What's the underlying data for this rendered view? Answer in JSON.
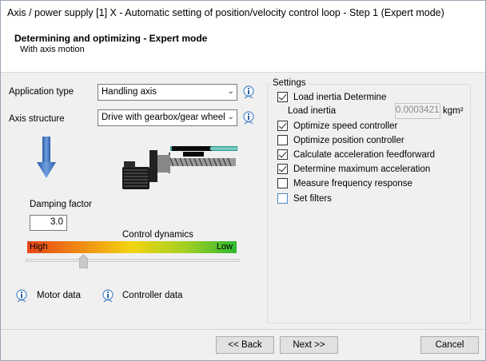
{
  "window": {
    "title": "Axis / power supply [1] X - Automatic setting of position/velocity control loop - Step 1 (Expert mode)"
  },
  "header": {
    "title": "Determining and optimizing - Expert mode",
    "subtitle": "With axis motion"
  },
  "left": {
    "application_type_label": "Application type",
    "application_type_value": "Handling axis",
    "axis_structure_label": "Axis structure",
    "axis_structure_value": "Drive with gearbox/gear wheel",
    "damping_factor_label": "Damping factor",
    "damping_factor_value": "3.0",
    "control_dynamics_label": "Control dynamics",
    "dynamics_high": "High",
    "dynamics_low": "Low",
    "control_dynamics_level": 0.27,
    "motor_data_label": "Motor data",
    "controller_data_label": "Controller data"
  },
  "settings": {
    "title": "Settings",
    "load_inertia_determine": {
      "label": "Load inertia Determine",
      "checked": true
    },
    "load_inertia_label": "Load inertia",
    "load_inertia_value": "0.0003421",
    "load_inertia_unit": "kgm²",
    "optimize_speed": {
      "label": "Optimize speed controller",
      "checked": true
    },
    "optimize_position": {
      "label": "Optimize position controller",
      "checked": false
    },
    "calc_accel_ff": {
      "label": "Calculate acceleration feedforward",
      "checked": true
    },
    "determine_max_accel": {
      "label": "Determine maximum acceleration",
      "checked": true
    },
    "measure_freq": {
      "label": "Measure frequency response",
      "checked": false
    },
    "set_filters": {
      "label": "Set filters",
      "checked": false
    }
  },
  "buttons": {
    "back": "<< Back",
    "next": "Next >>",
    "cancel": "Cancel"
  },
  "colors": {
    "accent_blue": "#4a86c8",
    "arrow_blue": "#4a74b8"
  }
}
